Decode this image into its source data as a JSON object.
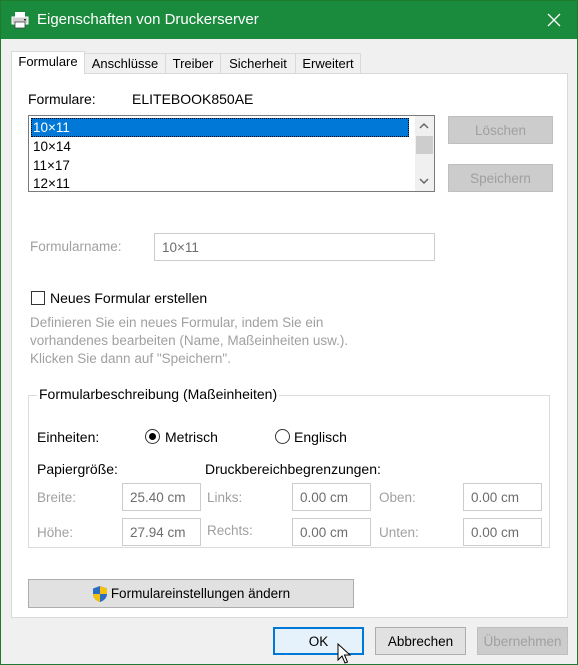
{
  "window": {
    "title": "Eigenschaften von Druckerserver",
    "accent": "#1a8a3d"
  },
  "tabs": [
    {
      "label": "Formulare"
    },
    {
      "label": "Anschlüsse"
    },
    {
      "label": "Treiber"
    },
    {
      "label": "Sicherheit"
    },
    {
      "label": "Erweitert"
    }
  ],
  "formulare": {
    "label": "Formulare:",
    "server": "ELITEBOOK850AE",
    "items": [
      "10×11",
      "10×14",
      "11×17",
      "12×11"
    ],
    "selected": "10×11"
  },
  "buttons": {
    "delete": "Löschen",
    "save": "Speichern",
    "change_settings": "Formulareinstellungen ändern",
    "ok": "OK",
    "cancel": "Abbrechen",
    "apply": "Übernehmen"
  },
  "form_name": {
    "label": "Formularname:",
    "value": "10×11"
  },
  "new_form": {
    "label": "Neues Formular erstellen",
    "checked": false,
    "description": [
      "Definieren Sie ein neues Formular, indem Sie ein",
      "vorhandenes bearbeiten (Name, Maßeinheiten usw.).",
      "Klicken Sie dann auf \"Speichern\"."
    ]
  },
  "description_group": {
    "title": "Formularbeschreibung (Maßeinheiten)",
    "units_label": "Einheiten:",
    "unit_metric": "Metrisch",
    "unit_english": "Englisch",
    "selected_unit": "Metrisch",
    "paper_size_label": "Papiergröße:",
    "print_area_label": "Druckbereichbegrenzungen:",
    "width_label": "Breite:",
    "width_value": "25.40 cm",
    "height_label": "Höhe:",
    "height_value": "27.94 cm",
    "left_label": "Links:",
    "left_value": "0.00 cm",
    "right_label": "Rechts:",
    "right_value": "0.00 cm",
    "top_label": "Oben:",
    "top_value": "0.00 cm",
    "bottom_label": "Unten:",
    "bottom_value": "0.00 cm"
  }
}
